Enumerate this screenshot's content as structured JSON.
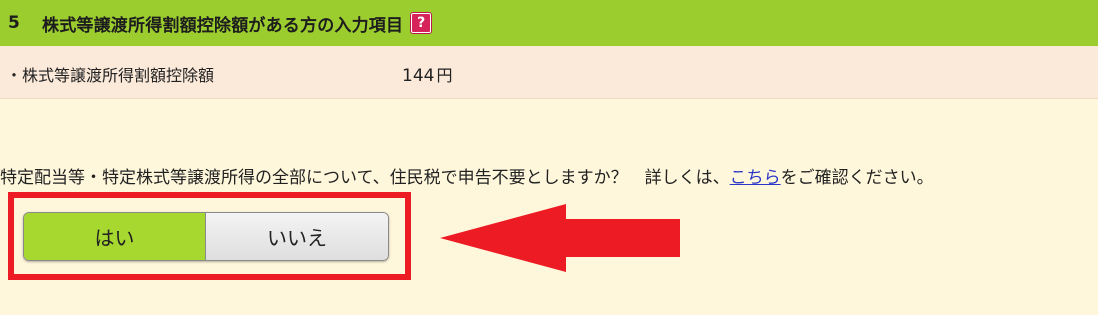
{
  "section": {
    "number": "5",
    "title": "株式等譲渡所得割額控除額がある方の入力項目",
    "help_icon_glyph": "?"
  },
  "deduction": {
    "label": "・株式等譲渡所得割額控除額",
    "value": "144",
    "unit": "円"
  },
  "question": {
    "text": "特定配当等・特定株式等譲渡所得の全部について、住民税で申告不要としますか？　詳しくは、",
    "link_text": "こちら",
    "suffix": "をご確認ください。"
  },
  "toggle": {
    "yes_label": "はい",
    "no_label": "いいえ",
    "selected": "はい"
  },
  "colors": {
    "header_bg": "#9ccd2f",
    "row_bg": "#fbe9da",
    "page_bg": "#fff7dc",
    "selected_bg": "#a6d830",
    "annotation_red": "#ed1c24",
    "link": "#2a36c8",
    "help_icon": "#d6245b"
  }
}
